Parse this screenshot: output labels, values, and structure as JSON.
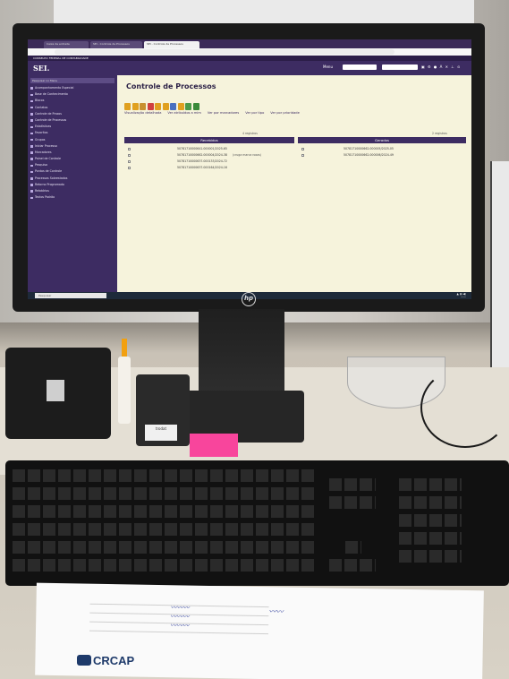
{
  "browser": {
    "tabs": [
      "Caixa de entrada",
      "SEI - Controle de Processos",
      "SEI - Controle de Processos"
    ]
  },
  "app": {
    "logo": "SEI.",
    "gov_bar": "CONSELHO FEDERAL DE CONTABILIDADE",
    "menu_label": "Menu"
  },
  "sidebar": {
    "search_placeholder": "Pesquisar no Menu",
    "items": [
      "Acompanhamento Especial",
      "Base de Conhecimento",
      "Blocos",
      "Contatos",
      "Controle de Prazos",
      "Controle de Processos",
      "Estatísticas",
      "Favoritos",
      "Grupos",
      "Iniciar Processo",
      "Marcadores",
      "Painel de Controle",
      "Pesquisa",
      "Pontos de Controle",
      "Processos Sobrestados",
      "Retorno Programado",
      "Relatórios",
      "Textos Padrão"
    ]
  },
  "main": {
    "page_title": "Controle de Processos",
    "subtabs": [
      "Visualização detalhada",
      "Ver atribuídos a mim",
      "Ver por marcadores",
      "Ver por tipo",
      "Ver por prioridade"
    ],
    "received": {
      "count_label": "4 registros",
      "header": "Recebidos",
      "rows": [
        "50781710000641.000001/2025-65",
        "50781710000662.000004/2024-38",
        "50781710000637.000133/2024-72",
        "50781710000637.000164/2024-16"
      ],
      "row_note": "(cruga marca roxas)"
    },
    "generated": {
      "count_label": "2 registros",
      "header": "Gerados",
      "rows": [
        "50781710000662.000005/2025-05",
        "50781710000662.000006/2024-49"
      ]
    }
  },
  "taskbar": {
    "search": "Pesquisar"
  },
  "desk": {
    "stamp_label": "trodat",
    "paper_logo": "CRCAP"
  }
}
